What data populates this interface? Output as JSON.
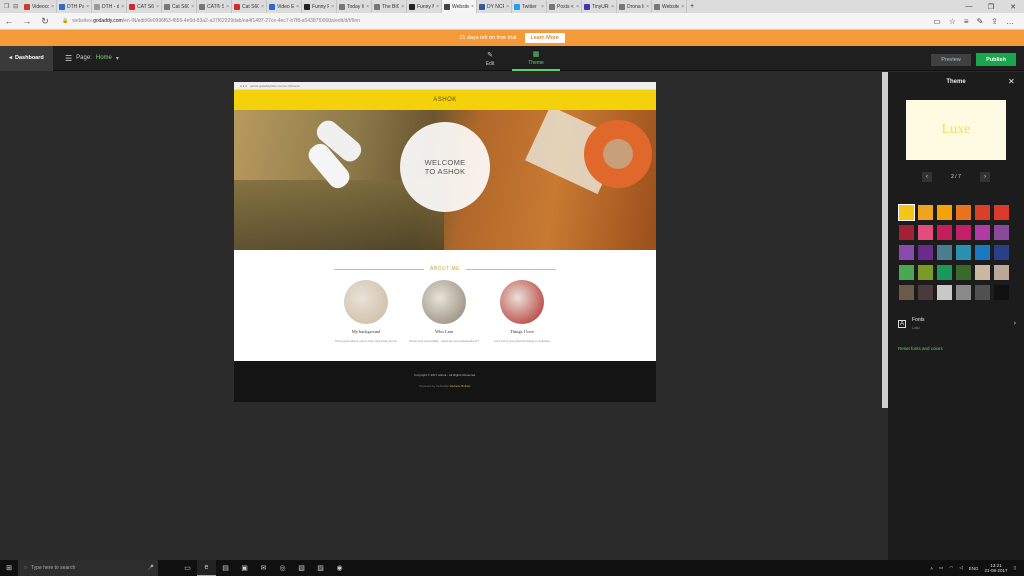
{
  "tabs": [
    {
      "label": "Videocon D2",
      "color": "#d03a2a"
    },
    {
      "label": "DTH Packages",
      "color": "#2b6cc4"
    },
    {
      "label": "DTH - direct",
      "color": "#999999"
    },
    {
      "label": "CAT S60 Revi",
      "color": "#d02a2a"
    },
    {
      "label": "Cat S60 revie",
      "color": "#777777"
    },
    {
      "label": "CAT® S60 Of",
      "color": "#777777"
    },
    {
      "label": "Cat S60 Revie",
      "color": "#d02a2a"
    },
    {
      "label": "Video Editor",
      "color": "#2a6ad0"
    },
    {
      "label": "Funny Picture",
      "color": "#222222"
    },
    {
      "label": "Today Will Be",
      "color": "#777777"
    },
    {
      "label": "The BIG Colle",
      "color": "#777777"
    },
    {
      "label": "Funny Meme",
      "color": "#222222"
    },
    {
      "label": "Website E",
      "color": "#444444",
      "active": true
    },
    {
      "label": "DY NCRs",
      "color": "#3b5998"
    },
    {
      "label": "Twitter",
      "color": "#1da1f2"
    },
    {
      "label": "Posts < NCMC",
      "color": "#777777"
    },
    {
      "label": "TinyURL.com",
      "color": "#3a3ab0"
    },
    {
      "label": "Drona Infotech",
      "color": "#777777"
    },
    {
      "label": "Website Builc",
      "color": "#777777"
    }
  ],
  "url": {
    "prefix": "websites.",
    "domain": "godaddy.com",
    "rest": "/en-IN/edit/6e0996f63-f656-4e6d-83a2-a37f62229dab/ea4f1497-27ce-4ec7-b7f8-a54387f0060a/edit/d/t/f/en"
  },
  "banner": {
    "text": "21 days left on free trial",
    "button": "Learn More"
  },
  "toolbar": {
    "dashboard": "Dashboard",
    "page_label": "Page:",
    "page_name": "Home",
    "edit_label": "Edit",
    "theme_label": "Theme",
    "preview": "Preview",
    "publish": "Publish"
  },
  "site": {
    "url_text": "ashok.godaddysites.com/en-IN/home",
    "header_title": "ASHOK",
    "hero_text": "WELCOME\nTO ASHOK",
    "about_title": "ABOUT ME",
    "cards": [
      {
        "title": "My background",
        "desc": "Tell people where you're from and what you do",
        "color": "#c9b8a0"
      },
      {
        "title": "Who I am",
        "desc": "Show your personality · what are you passionate in?",
        "color": "#8a8070"
      },
      {
        "title": "Things I love",
        "desc": "Let's list of your favorite things or activities",
        "color": "#b02020"
      }
    ],
    "footer_copyright": "Copyright © 2017 Ashok - All Rights Reserved.",
    "footer_powered": "Powered by GoDaddy",
    "footer_builder": "Website Builder"
  },
  "panel": {
    "title": "Theme",
    "theme_name": "Luxe",
    "pager": "2 / 7",
    "swatches": [
      "#f5c518",
      "#f0a31c",
      "#f5a30a",
      "#e8741e",
      "#d9402a",
      "#d93a2a",
      "#a02233",
      "#e34c7e",
      "#c21f5c",
      "#c4206a",
      "#b03aa8",
      "#8a4a9a",
      "#8a4ab0",
      "#6a2c8a",
      "#4a7d90",
      "#2a90b0",
      "#1a78c0",
      "#2a3e8a",
      "#4aa854",
      "#7a9a2a",
      "#1a9a5a",
      "#3a6a2a",
      "#c8b8a0",
      "#b8a898",
      "#6a5a4a",
      "#4a3a3a",
      "#c8c8c8",
      "#8a8a8a",
      "#505050",
      "#111111"
    ],
    "selected_swatch": 0,
    "fonts_label": "Fonts",
    "fonts_value": "Lato",
    "reset": "Reset fonts and colors"
  },
  "taskbar": {
    "search": "Type here to search",
    "lang": "ENG",
    "time": "13:21",
    "date": "21-08-2017"
  }
}
